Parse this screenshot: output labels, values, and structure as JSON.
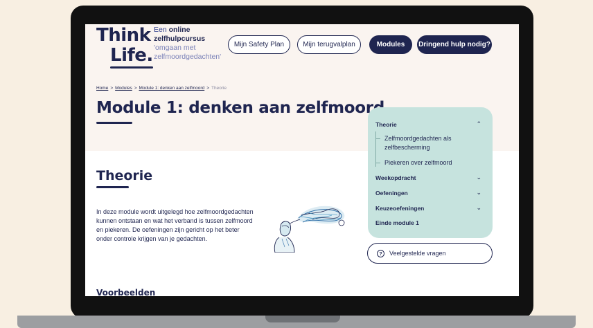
{
  "logo": {
    "line1": "Think",
    "line2": "Life."
  },
  "tagline": {
    "pre": "Een",
    "bold1": "online",
    "bold2": "zelfhulpcursus",
    "soft1": "'omgaan met",
    "soft2": "zelfmoordgedachten'"
  },
  "nav": {
    "safety_plan": "Mijn Safety Plan",
    "terugvalplan": "Mijn terugvalplan",
    "modules": "Modules",
    "urgent_help": "Dringend hulp nodig?"
  },
  "breadcrumb": {
    "home": "Home",
    "modules": "Modules",
    "module": "Module 1: denken aan zelfmoord",
    "current": "Theorie",
    "separator": ">"
  },
  "page_title": "Module 1: denken aan zelfmoord",
  "section_title": "Theorie",
  "body_text": "In deze module wordt uitgelegd hoe zelfmoordgedachten kunnen ontstaan en wat het verband is tussen zelfmoord en piekeren. De oefeningen zijn gericht op het beter onder controle krijgen van je gedachten.",
  "subsection_title": "Voorbeelden",
  "side_nav": {
    "theorie": "Theorie",
    "sub1": "Zelfmoordgedachten als zelfbescherming",
    "sub2": "Piekeren over zelfmoord",
    "weekopdracht": "Weekopdracht",
    "oefeningen": "Oefeningen",
    "keuzeoefeningen": "Keuzeoefeningen",
    "einde": "Einde module 1"
  },
  "faq": "Veelgestelde vragen",
  "icons": {
    "chevron_up": "chevron-up-icon",
    "chevron_down": "chevron-down-icon",
    "question": "question-circle-icon"
  },
  "colors": {
    "navy": "#1f2550",
    "mint": "#c6e3de",
    "hero_bg": "#faf4f0",
    "page_bg": "#f8efe2"
  }
}
